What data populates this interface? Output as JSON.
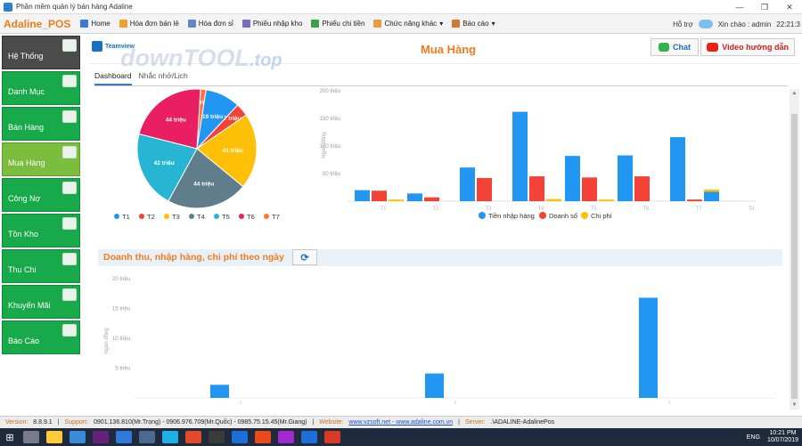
{
  "window": {
    "title": "Phần mềm quản lý bán hàng Adaline",
    "min": "—",
    "restore": "❐",
    "close": "✕"
  },
  "menubar": {
    "brand": "Adaline_POS",
    "items": [
      {
        "label": "Home",
        "color": "#3a7bd5"
      },
      {
        "label": "Hóa đơn bán lẻ",
        "color": "#f0a030"
      },
      {
        "label": "Hóa đơn sỉ",
        "color": "#5a8ac0"
      },
      {
        "label": "Phiếu nhập kho",
        "color": "#7a6ac0"
      },
      {
        "label": "Phiếu chi tiền",
        "color": "#3aa04a"
      },
      {
        "label": "Chức năng khác",
        "color": "#e0a040"
      },
      {
        "label": "Báo cáo",
        "color": "#d07a30"
      }
    ],
    "help": "Hỗ trợ",
    "greeting": "Xin chào : admin",
    "time": "22:21:3"
  },
  "sidebar": {
    "items": [
      {
        "label": "Hệ Thống"
      },
      {
        "label": "Danh Mục"
      },
      {
        "label": "Bán Hàng"
      },
      {
        "label": "Mua Hàng"
      },
      {
        "label": "Công Nợ"
      },
      {
        "label": "Tồn Kho"
      },
      {
        "label": "Thu Chi"
      },
      {
        "label": "Khuyến Mãi"
      },
      {
        "label": "Báo Cáo"
      }
    ]
  },
  "header": {
    "teamview": "Teamview",
    "watermark": "downTOOL",
    "watermark_suffix": ".top",
    "title": "Mua Hàng",
    "chat": "Chat",
    "video": "Video hướng dẫn"
  },
  "tabs": [
    {
      "label": "Dashboard"
    },
    {
      "label": "Nhắc nhở/Lịch"
    }
  ],
  "section": {
    "title": "Doanh thu, nhập hàng, chi phí theo ngày",
    "refresh": "⟳"
  },
  "chart_data": [
    {
      "type": "pie",
      "slices": [
        {
          "label": "T1",
          "value": 19,
          "display": "19 triệu",
          "color": "#2196f3"
        },
        {
          "label": "T2",
          "value": 7,
          "display": "7 triệu",
          "color": "#f44336"
        },
        {
          "label": "T3",
          "value": 41,
          "display": "41 triệu",
          "color": "#ffc107"
        },
        {
          "label": "T4",
          "value": 44,
          "display": "44 triệu",
          "color": "#607d8b"
        },
        {
          "label": "T5",
          "value": 42,
          "display": "42 triệu",
          "color": "#26b6d4"
        },
        {
          "label": "T6",
          "value": 44,
          "display": "44 triệu",
          "color": "#e91e63"
        },
        {
          "label": "T7",
          "value": 3,
          "display": "3 triệu",
          "color": "#ff7043"
        }
      ],
      "legend": [
        "T1",
        "T2",
        "T3",
        "T4",
        "T5",
        "T6",
        "T7"
      ]
    },
    {
      "type": "bar",
      "ylabel": "Ngàn đồng",
      "yticks": [
        "200 triệu",
        "150 triệu",
        "100 triệu",
        "50 triệu"
      ],
      "ylim": [
        0,
        200
      ],
      "categories": [
        "T1",
        "T2",
        "T3",
        "T4",
        "T5",
        "T6",
        "T7"
      ],
      "tick_labels": [
        "T1",
        "T2",
        "T3",
        "T4",
        "T5",
        "T6",
        "T7",
        "T8"
      ],
      "series": [
        {
          "name": "Tiền nhập hàng",
          "color": "#2196f3",
          "values": [
            20,
            14,
            61,
            162,
            82,
            83,
            116
          ]
        },
        {
          "name": "Doanh số",
          "color": "#f44336",
          "values": [
            19,
            7,
            42,
            45,
            43,
            45,
            3
          ]
        },
        {
          "name": "Chi phí",
          "color": "#ffc107",
          "values": [
            3,
            0,
            0,
            4,
            3,
            0,
            21
          ]
        }
      ],
      "extra_bar": {
        "value": 17,
        "color": "#2196f3"
      }
    },
    {
      "type": "bar",
      "ylabel": "Ngàn đồng",
      "yticks": [
        "20 triệu",
        "15 triệu",
        "10 triệu",
        "5 triệu"
      ],
      "ylim": [
        0,
        20
      ],
      "series": [
        {
          "name": "Tiền nhập hàng",
          "color": "#2196f3",
          "values": [
            2.2,
            4.1,
            16.8
          ]
        }
      ],
      "tick_labels": [
        "3",
        "6",
        "9"
      ]
    }
  ],
  "status": {
    "version_label": "Version:",
    "version": "8.8.9.1",
    "support_label": "Support:",
    "support": "0901.136.810(Mr.Trọng) - 0906.976.709(Mr.Quốc) - 0985.75.15.45(Mr.Giang)",
    "website_label": "Website:",
    "website": "www.vzsoft.net - www.adaline.com.vn",
    "server_label": "Server:",
    "server": ".\\ADALINE-AdalinePos"
  },
  "taskbar": {
    "apps": [
      "#7a7a8a",
      "#ffcb3b",
      "#3b8ad8",
      "#68217a",
      "#2f7ad8",
      "#4a6a90",
      "#1eb1e8",
      "#e04a2a",
      "#3b3b3b",
      "#1d6fd8",
      "#e84a1a",
      "#a02ad0",
      "#1e6fd8",
      "#d83a2a"
    ],
    "lang": "ENG",
    "time": "10:21 PM",
    "date": "10/07/2019"
  }
}
